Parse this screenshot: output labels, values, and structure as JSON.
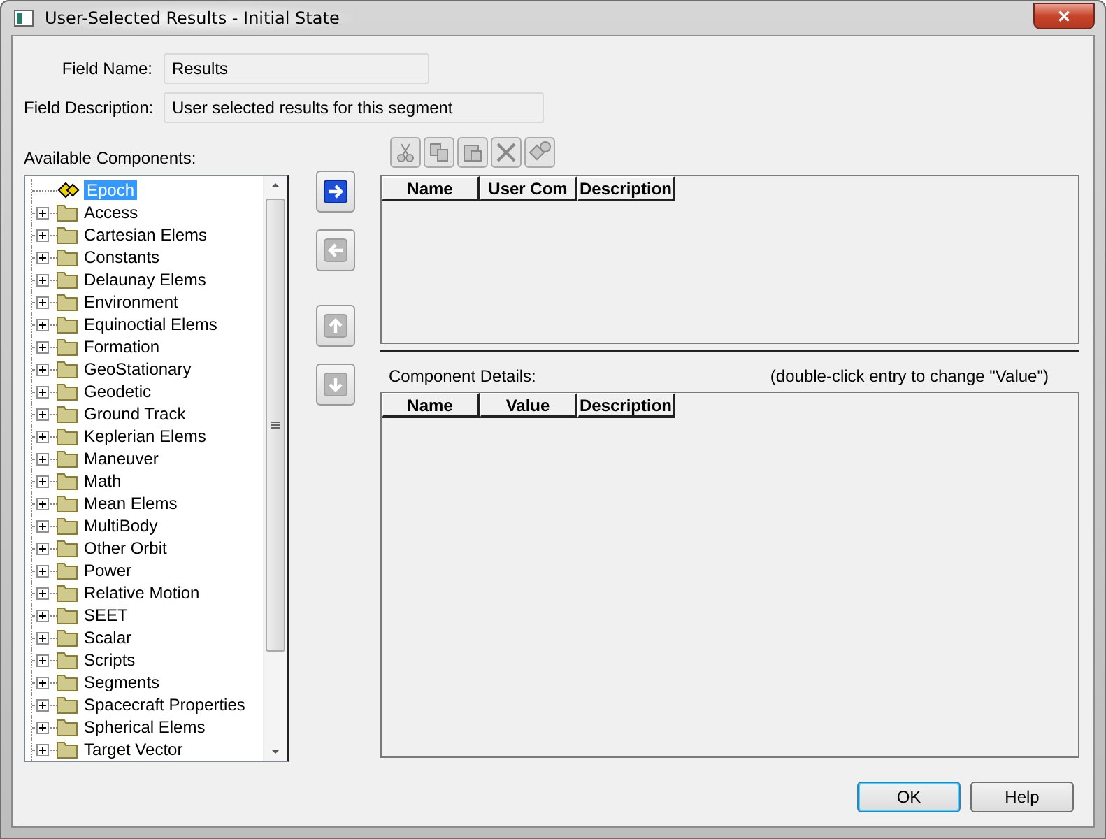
{
  "window": {
    "title": "User-Selected Results - Initial State",
    "close": "✕"
  },
  "fields": [
    {
      "label": "Field Name:",
      "value": "Results",
      "wide": false
    },
    {
      "label": "Field Description:",
      "value": "User selected results for this segment",
      "wide": true
    }
  ],
  "available_label": "Available Components:",
  "tree": [
    {
      "label": "Epoch",
      "kind": "leaf",
      "selected": true
    },
    {
      "label": "Access",
      "kind": "folder",
      "selected": false
    },
    {
      "label": "Cartesian Elems",
      "kind": "folder",
      "selected": false
    },
    {
      "label": "Constants",
      "kind": "folder",
      "selected": false
    },
    {
      "label": "Delaunay Elems",
      "kind": "folder",
      "selected": false
    },
    {
      "label": "Environment",
      "kind": "folder",
      "selected": false
    },
    {
      "label": "Equinoctial Elems",
      "kind": "folder",
      "selected": false
    },
    {
      "label": "Formation",
      "kind": "folder",
      "selected": false
    },
    {
      "label": "GeoStationary",
      "kind": "folder",
      "selected": false
    },
    {
      "label": "Geodetic",
      "kind": "folder",
      "selected": false
    },
    {
      "label": "Ground Track",
      "kind": "folder",
      "selected": false
    },
    {
      "label": "Keplerian Elems",
      "kind": "folder",
      "selected": false
    },
    {
      "label": "Maneuver",
      "kind": "folder",
      "selected": false
    },
    {
      "label": "Math",
      "kind": "folder",
      "selected": false
    },
    {
      "label": "Mean Elems",
      "kind": "folder",
      "selected": false
    },
    {
      "label": "MultiBody",
      "kind": "folder",
      "selected": false
    },
    {
      "label": "Other Orbit",
      "kind": "folder",
      "selected": false
    },
    {
      "label": "Power",
      "kind": "folder",
      "selected": false
    },
    {
      "label": "Relative Motion",
      "kind": "folder",
      "selected": false
    },
    {
      "label": "SEET",
      "kind": "folder",
      "selected": false
    },
    {
      "label": "Scalar",
      "kind": "folder",
      "selected": false
    },
    {
      "label": "Scripts",
      "kind": "folder",
      "selected": false
    },
    {
      "label": "Segments",
      "kind": "folder",
      "selected": false
    },
    {
      "label": "Spacecraft Properties",
      "kind": "folder",
      "selected": false
    },
    {
      "label": "Spherical Elems",
      "kind": "folder",
      "selected": false
    },
    {
      "label": "Target Vector",
      "kind": "folder",
      "selected": false
    }
  ],
  "move_buttons": [
    {
      "kind": "right",
      "disabled": false
    },
    {
      "kind": "left",
      "disabled": true
    },
    {
      "kind": "up",
      "disabled": true
    },
    {
      "kind": "down",
      "disabled": true
    }
  ],
  "toolbar": [
    {
      "kind": "cut",
      "disabled": true
    },
    {
      "kind": "copy",
      "disabled": true
    },
    {
      "kind": "paste",
      "disabled": true
    },
    {
      "kind": "delete",
      "disabled": true
    },
    {
      "kind": "add",
      "disabled": true
    }
  ],
  "selected_table": {
    "columns": [
      "Name",
      "User Com",
      "Description"
    ]
  },
  "details": {
    "label": "Component Details:",
    "hint": "(double-click entry to change \"Value\")",
    "columns": [
      "Name",
      "Value",
      "Description"
    ]
  },
  "buttons": [
    {
      "label": "OK",
      "default": true
    },
    {
      "label": "Help",
      "default": false
    }
  ]
}
